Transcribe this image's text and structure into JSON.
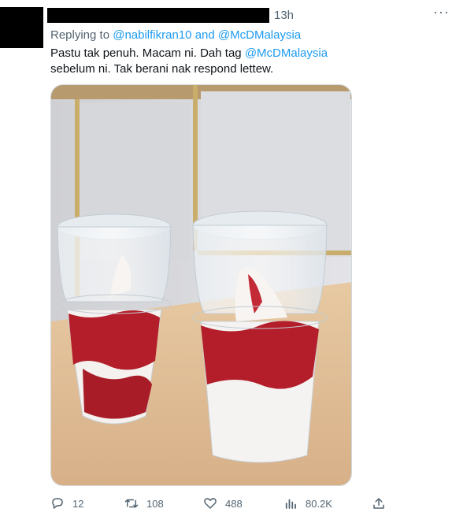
{
  "tweet": {
    "time": "13h",
    "more_icon": "more-dots-icon",
    "replying_prefix": "Replying to",
    "reply_handle_1": "@nabilfikran10",
    "reply_and": "and",
    "reply_handle_2": "@McDMalaysia",
    "text_part1": "Pastu tak penuh. Macam ni. Dah tag",
    "text_mention": "@McDMalaysia",
    "text_part2": "sebelum ni. Tak berani nak respond lettew."
  },
  "actions": {
    "reply_count": "12",
    "retweet_count": "108",
    "like_count": "488",
    "views_count": "80.2K"
  },
  "colors": {
    "link": "#1d9bf0",
    "muted": "#536471",
    "text": "#0f1419"
  }
}
